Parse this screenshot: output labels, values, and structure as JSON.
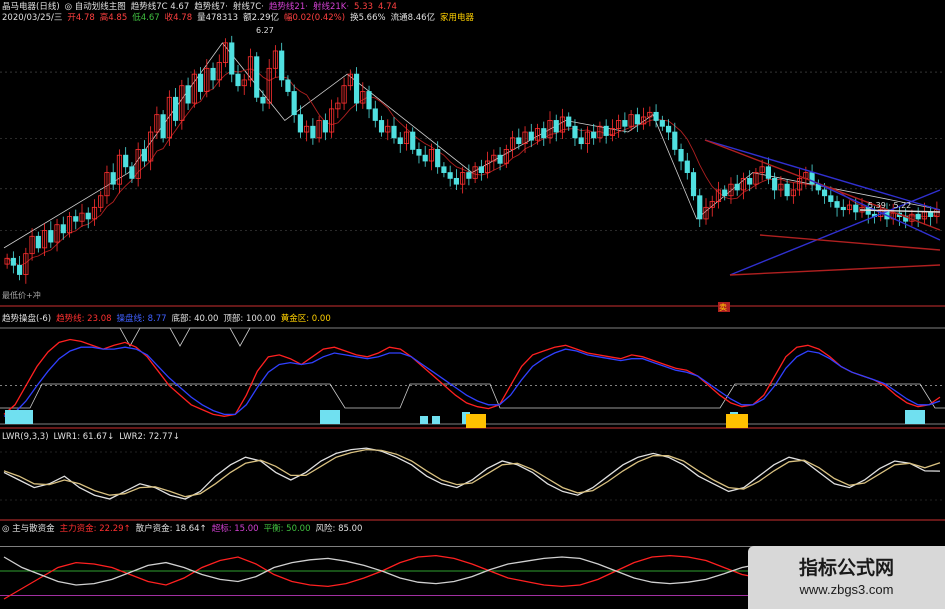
{
  "header": {
    "row1": [
      {
        "t": "晶马电器(日线)",
        "c": "#e0e0e0"
      },
      {
        "t": "◎ 自动划线主图",
        "c": "#e0e0e0"
      },
      {
        "t": "趋势线7C 4.67",
        "c": "#e0e0e0"
      },
      {
        "t": "趋势线7·",
        "c": "#e0e0e0"
      },
      {
        "t": "射线7C·",
        "c": "#e0e0e0"
      },
      {
        "t": "趋势线21·",
        "c": "#d040d0"
      },
      {
        "t": "射线21K·",
        "c": "#d040d0"
      },
      {
        "t": "5.33",
        "c": "#ff4040"
      },
      {
        "t": "4.74",
        "c": "#ff4040"
      }
    ],
    "row2": [
      {
        "t": "2020/03/25/三",
        "c": "#e0e0e0"
      },
      {
        "t": "开4.78",
        "c": "#ff4040"
      },
      {
        "t": "高4.85",
        "c": "#ff4040"
      },
      {
        "t": "低4.67",
        "c": "#40c040"
      },
      {
        "t": "收4.78",
        "c": "#ff4040"
      },
      {
        "t": "量478313",
        "c": "#e0e0e0"
      },
      {
        "t": "额2.29亿",
        "c": "#e0e0e0"
      },
      {
        "t": "幅0.02(0.42%)",
        "c": "#ff4040"
      },
      {
        "t": "换5.66%",
        "c": "#e0e0e0"
      },
      {
        "t": "流通8.46亿",
        "c": "#e0e0e0"
      },
      {
        "t": "家用电器",
        "c": "#ffd000"
      }
    ],
    "panel2": [
      {
        "t": "趋势操盘(-6)",
        "c": "#e0e0e0"
      },
      {
        "t": "趋势线: 23.08",
        "c": "#ff3030"
      },
      {
        "t": "操盘线: 8.77",
        "c": "#4060ff"
      },
      {
        "t": "底部: 40.00",
        "c": "#e0e0e0"
      },
      {
        "t": "顶部: 100.00",
        "c": "#e0e0e0"
      },
      {
        "t": "黄金区: 0.00",
        "c": "#ffd000"
      }
    ],
    "panel3": [
      {
        "t": "LWR(9,3,3)",
        "c": "#e0e0e0"
      },
      {
        "t": "LWR1: 61.67↓",
        "c": "#e0e0e0"
      },
      {
        "t": "LWR2: 72.77↓",
        "c": "#e0e0e0"
      }
    ],
    "panel4": [
      {
        "t": "◎ 主与散资金",
        "c": "#e0e0e0"
      },
      {
        "t": "主力资金: 22.29↑",
        "c": "#ff3030"
      },
      {
        "t": "散户资金: 18.64↑",
        "c": "#e0e0e0"
      },
      {
        "t": "超标: 15.00",
        "c": "#d040d0"
      },
      {
        "t": "平衡: 50.00",
        "c": "#40c040"
      },
      {
        "t": "风险: 85.00",
        "c": "#e0e0e0"
      }
    ]
  },
  "annotations": {
    "high_label": "6.27",
    "low_label": "最低价+冲",
    "right_labels": "5.39 · 5.22",
    "signal_label": "卖"
  },
  "watermark": {
    "title": "指标公式网",
    "url": "www.zbgs3.com"
  },
  "chart_data": [
    {
      "type": "candlestick",
      "title": "自动划线主图",
      "n_bars": 150,
      "ylim": [
        4.0,
        6.4
      ],
      "closes": [
        4.36,
        4.3,
        4.22,
        4.4,
        4.55,
        4.45,
        4.6,
        4.5,
        4.65,
        4.58,
        4.72,
        4.68,
        4.75,
        4.7,
        4.8,
        4.9,
        5.1,
        5.0,
        5.25,
        5.15,
        5.05,
        5.3,
        5.2,
        5.45,
        5.6,
        5.4,
        5.75,
        5.55,
        5.85,
        5.7,
        5.95,
        5.8,
        6.0,
        5.9,
        6.05,
        6.22,
        5.95,
        5.85,
        5.9,
        6.1,
        5.75,
        5.7,
        6.0,
        6.15,
        5.9,
        5.8,
        5.6,
        5.45,
        5.5,
        5.4,
        5.55,
        5.45,
        5.65,
        5.7,
        5.85,
        5.95,
        5.7,
        5.8,
        5.65,
        5.55,
        5.45,
        5.5,
        5.4,
        5.35,
        5.45,
        5.3,
        5.25,
        5.2,
        5.3,
        5.15,
        5.1,
        5.05,
        5.0,
        5.1,
        5.05,
        5.15,
        5.1,
        5.2,
        5.25,
        5.18,
        5.3,
        5.4,
        5.35,
        5.45,
        5.38,
        5.48,
        5.4,
        5.55,
        5.45,
        5.58,
        5.5,
        5.4,
        5.35,
        5.45,
        5.4,
        5.5,
        5.42,
        5.48,
        5.55,
        5.5,
        5.6,
        5.52,
        5.58,
        5.62,
        5.55,
        5.5,
        5.45,
        5.3,
        5.2,
        5.1,
        4.9,
        4.7,
        4.8,
        4.85,
        4.95,
        4.9,
        5.0,
        4.95,
        5.05,
        5.0,
        5.1,
        5.15,
        5.05,
        4.95,
        5.0,
        4.9,
        4.95,
        5.05,
        5.1,
        5.0,
        4.95,
        4.9,
        4.85,
        4.8,
        4.78,
        4.82,
        4.76,
        4.8,
        4.74,
        4.72,
        4.78,
        4.7,
        4.75,
        4.72,
        4.68,
        4.74,
        4.7,
        4.76,
        4.72,
        4.78
      ],
      "trend_points": [
        [
          0,
          4.45
        ],
        [
          20,
          5.1
        ],
        [
          35,
          6.22
        ],
        [
          45,
          5.55
        ],
        [
          55,
          5.95
        ],
        [
          75,
          5.1
        ],
        [
          90,
          5.55
        ],
        [
          100,
          5.45
        ],
        [
          104,
          5.6
        ],
        [
          111,
          4.7
        ],
        [
          120,
          5.1
        ],
        [
          150,
          4.78
        ]
      ]
    },
    {
      "type": "line",
      "title": "趋势操盘(-6)",
      "ylim": [
        0,
        100
      ],
      "series": [
        {
          "name": "趋势线",
          "values": [
            10,
            20,
            40,
            60,
            75,
            85,
            88,
            86,
            82,
            78,
            82,
            85,
            80,
            70,
            55,
            40,
            30,
            20,
            15,
            10,
            8,
            10,
            30,
            55,
            70,
            72,
            68,
            62,
            70,
            78,
            80,
            76,
            72,
            70,
            74,
            80,
            78,
            70,
            60,
            50,
            40,
            30,
            22,
            18,
            16,
            20,
            40,
            60,
            72,
            76,
            80,
            82,
            78,
            74,
            72,
            70,
            68,
            72,
            70,
            66,
            62,
            58,
            56,
            50,
            40,
            30,
            22,
            18,
            20,
            30,
            50,
            70,
            80,
            82,
            78,
            70,
            60,
            54,
            50,
            46,
            40,
            30,
            22,
            18,
            20,
            28
          ]
        },
        {
          "name": "操盘线",
          "values": [
            8,
            12,
            24,
            40,
            55,
            68,
            76,
            80,
            80,
            78,
            78,
            80,
            78,
            72,
            60,
            48,
            38,
            28,
            20,
            14,
            10,
            10,
            20,
            38,
            54,
            62,
            64,
            62,
            64,
            70,
            74,
            72,
            70,
            68,
            70,
            74,
            74,
            70,
            62,
            54,
            46,
            38,
            30,
            24,
            20,
            20,
            30,
            46,
            60,
            68,
            74,
            78,
            76,
            72,
            70,
            68,
            66,
            68,
            68,
            64,
            60,
            56,
            54,
            50,
            42,
            34,
            26,
            20,
            20,
            26,
            40,
            58,
            70,
            76,
            74,
            68,
            60,
            54,
            50,
            46,
            42,
            34,
            26,
            20,
            20,
            24
          ]
        }
      ]
    },
    {
      "type": "line",
      "title": "LWR(9,3,3)",
      "ylim": [
        0,
        100
      ],
      "series": [
        {
          "name": "LWR1",
          "values": [
            60,
            50,
            40,
            45,
            55,
            40,
            30,
            25,
            35,
            45,
            40,
            30,
            25,
            35,
            55,
            70,
            80,
            75,
            60,
            50,
            60,
            75,
            85,
            90,
            92,
            88,
            80,
            70,
            55,
            45,
            40,
            50,
            65,
            75,
            70,
            60,
            45,
            35,
            30,
            40,
            55,
            70,
            80,
            85,
            80,
            70,
            55,
            45,
            35,
            40,
            55,
            70,
            80,
            75,
            60,
            45,
            40,
            50,
            65,
            75,
            72,
            62,
            61.67
          ]
        },
        {
          "name": "LWR2",
          "values": [
            62,
            55,
            45,
            44,
            50,
            45,
            36,
            30,
            32,
            40,
            41,
            35,
            28,
            32,
            45,
            60,
            72,
            76,
            68,
            56,
            56,
            68,
            80,
            86,
            90,
            89,
            84,
            75,
            62,
            50,
            44,
            46,
            58,
            70,
            72,
            64,
            52,
            40,
            33,
            36,
            48,
            62,
            74,
            82,
            82,
            75,
            62,
            50,
            40,
            38,
            48,
            62,
            74,
            76,
            66,
            52,
            43,
            46,
            58,
            70,
            72,
            66,
            72.77
          ]
        }
      ]
    },
    {
      "type": "line",
      "title": "主与散资金",
      "ylim": [
        0,
        100
      ],
      "series": [
        {
          "name": "主力资金",
          "values": [
            10,
            25,
            40,
            55,
            62,
            60,
            55,
            45,
            35,
            30,
            40,
            55,
            65,
            70,
            60,
            45,
            35,
            30,
            28,
            32,
            40,
            50,
            62,
            70,
            72,
            68,
            60,
            50,
            40,
            35,
            30,
            28,
            30,
            38,
            50,
            62,
            70,
            72,
            70,
            65,
            55,
            45,
            40,
            48,
            60,
            72,
            78,
            75,
            65,
            50,
            35,
            25,
            22.29
          ]
        },
        {
          "name": "散户资金",
          "values": [
            70,
            55,
            45,
            35,
            30,
            32,
            38,
            48,
            58,
            62,
            55,
            45,
            38,
            35,
            42,
            55,
            62,
            66,
            68,
            64,
            58,
            50,
            40,
            34,
            32,
            35,
            42,
            52,
            60,
            64,
            68,
            70,
            68,
            60,
            50,
            40,
            34,
            32,
            34,
            38,
            46,
            55,
            60,
            52,
            42,
            32,
            26,
            28,
            36,
            46,
            56,
            40,
            18.64
          ]
        }
      ]
    }
  ]
}
